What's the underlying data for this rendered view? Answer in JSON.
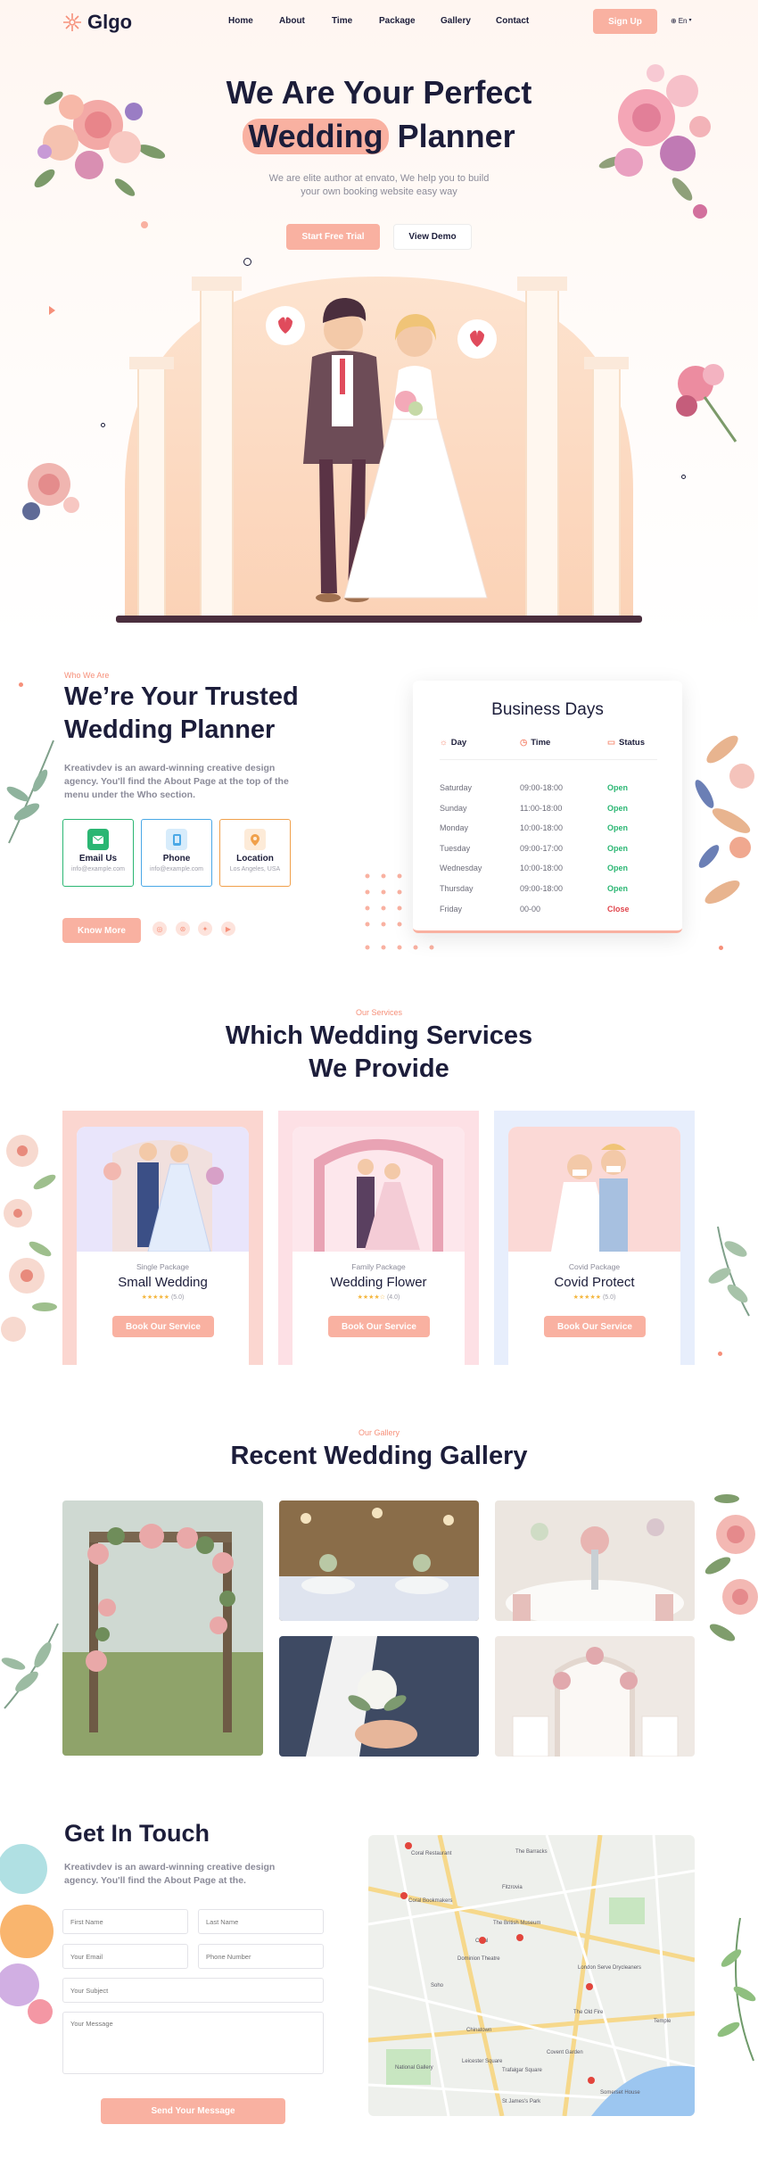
{
  "brand": {
    "name": "Glgo",
    "accent": "#f9b1a1",
    "navy": "#1c1d3a"
  },
  "nav": {
    "items": [
      "Home",
      "About",
      "Time",
      "Package",
      "Gallery",
      "Contact"
    ],
    "signup": "Sign Up",
    "lang": "En"
  },
  "hero": {
    "line1": "We Are Your Perfect",
    "highlight": "Wedding",
    "line2_rest": "Planner",
    "subtitle": "We are elite author at envato, We help you to build your own booking website easy way",
    "cta_primary": "Start Free Trial",
    "cta_secondary": "View Demo"
  },
  "about": {
    "tag": "Who We Are",
    "title": "We’re Your Trusted Wedding Planner",
    "text": "Kreativdev is an award-winning creative design agency. You'll find the About Page at the top of the menu under the Who section.",
    "cards": [
      {
        "title": "Email Us",
        "value": "info@example.com",
        "icon": "mail-icon",
        "color": "#2bb673"
      },
      {
        "title": "Phone",
        "value": "info@example.com",
        "icon": "phone-icon",
        "color": "#4aa8e6"
      },
      {
        "title": "Location",
        "value": "Los Angeles, USA",
        "icon": "location-pin-icon",
        "color": "#f0a04b"
      }
    ],
    "button": "Know More",
    "socials": [
      "instagram-icon",
      "dribbble-icon",
      "twitter-icon",
      "youtube-icon"
    ]
  },
  "business": {
    "title": "Business Days",
    "headers": [
      "Day",
      "Time",
      "Status"
    ],
    "rows": [
      {
        "day": "Saturday",
        "time": "09:00-18:00",
        "status": "Open"
      },
      {
        "day": "Sunday",
        "time": "11:00-18:00",
        "status": "Open"
      },
      {
        "day": "Monday",
        "time": "10:00-18:00",
        "status": "Open"
      },
      {
        "day": "Tuesday",
        "time": "09:00-17:00",
        "status": "Open"
      },
      {
        "day": "Wednesday",
        "time": "10:00-18:00",
        "status": "Open"
      },
      {
        "day": "Thursday",
        "time": "09:00-18:00",
        "status": "Open"
      },
      {
        "day": "Friday",
        "time": "00-00",
        "status": "Close"
      }
    ],
    "open_color": "#2bb673",
    "close_color": "#e0454c"
  },
  "services": {
    "tag": "Our Services",
    "title_line1": "Which Wedding Services",
    "title_line2": "We Provide",
    "items": [
      {
        "category": "Single Package",
        "name": "Small Wedding",
        "rating": "(5.0)",
        "button": "Book Our Service",
        "bg": "#fbd6d0"
      },
      {
        "category": "Family Package",
        "name": "Wedding Flower",
        "rating": "(4.0)",
        "button": "Book Our Service",
        "bg": "#fde0e5"
      },
      {
        "category": "Covid Package",
        "name": "Covid Protect",
        "rating": "(5.0)",
        "button": "Book Our Service",
        "bg": "#e7eefc"
      }
    ]
  },
  "gallery": {
    "tag": "Our Gallery",
    "title": "Recent Wedding Gallery"
  },
  "contact": {
    "title": "Get In Touch",
    "text": "Kreativdev is an award-winning creative design agency. You'll find the About Page at the.",
    "first_name": "First Name",
    "last_name": "Last Name",
    "email": "Your Email",
    "phone": "Phone Number",
    "subject": "Your Subject",
    "message": "Your Message",
    "button": "Send Your Message"
  },
  "map": {
    "labels": [
      "The Barracks",
      "Coral Restaurant",
      "Fitzrovia",
      "The British Museum",
      "Coral Bookmakers",
      "Coral",
      "Dominion Theatre",
      "London Serve Drycleaners",
      "Soho",
      "The Old Fire",
      "Chinatown",
      "Leicester Square",
      "Trafalgar Square",
      "National Gallery",
      "Covent Garden",
      "Somerset House",
      "Temple",
      "St James's Park"
    ]
  }
}
